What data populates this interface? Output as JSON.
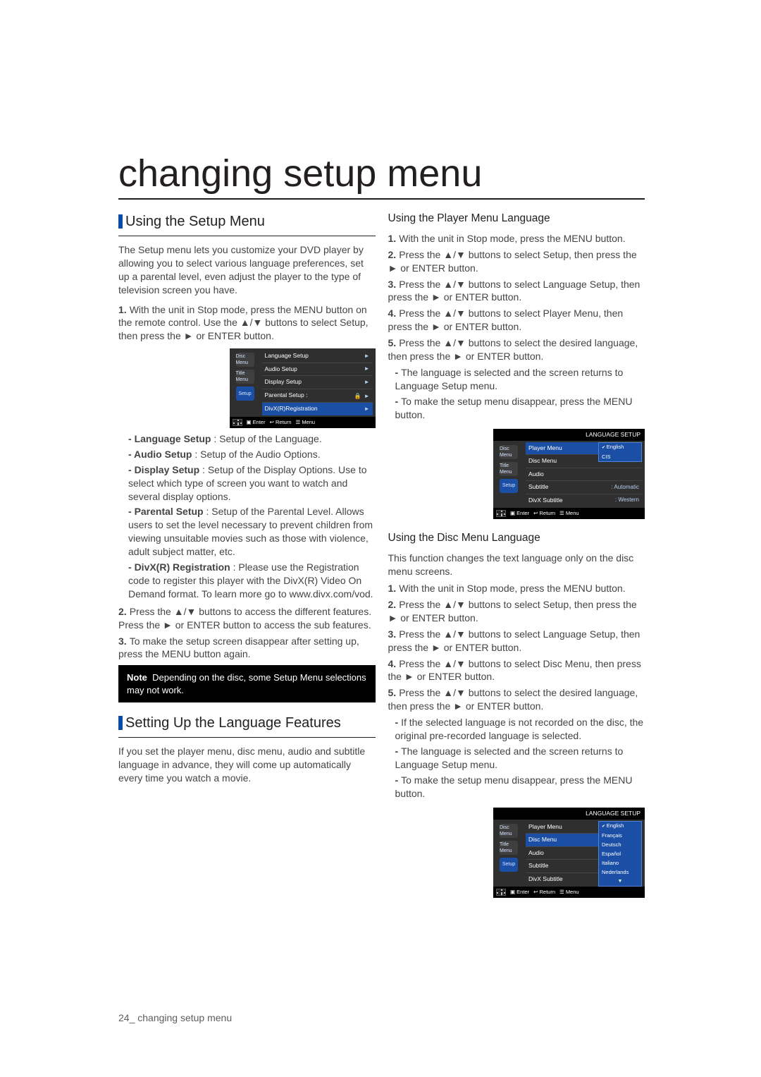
{
  "page_number_label": "24_ changing setup menu",
  "title": "changing setup menu",
  "left": {
    "h2": "Using the Setup Menu",
    "intro": "The Setup menu lets you customize your DVD player by allowing you to select various language preferences, set up a parental level, even adjust the player to the type of television screen you have.",
    "steps": [
      "With the unit in Stop mode, press the MENU button on the remote control. Use the ▲/▼ buttons to select Setup, then press the ► or ENTER button.",
      "Press the ▲/▼ buttons to access the different features. Press the ► or ENTER button to access the sub features.",
      "To make the setup screen disappear after setting up, press the MENU button again."
    ],
    "menu_items": [
      {
        "name": "Language Setup",
        "desc": "Setup of the Language."
      },
      {
        "name": "Audio Setup",
        "desc": "Setup of the Audio Options."
      },
      {
        "name": "Display Setup",
        "desc": "Setup of the Display Options. Use to select which type of screen you want to watch and several display options."
      },
      {
        "name": "Parental Setup",
        "desc": "Setup of the Parental Level. Allows users to set the level necessary to prevent children from viewing unsuitable movies such as those with violence, adult subject matter, etc."
      },
      {
        "name": "DivX(R) Registration",
        "desc": "Please use the Registration code to register this player with the DivX(R) Video On Demand format. To learn more go to www.divx.com/vod."
      }
    ],
    "note": "Depending on the disc, some Setup Menu selections may not work.",
    "lang_h2": "Setting Up the Language Features",
    "lang_p": "If you set the player menu, disc menu, audio and subtitle language in advance, they will come up automatically every time you watch a movie.",
    "mock1": {
      "rows": [
        {
          "l": "Language Setup",
          "r": "►"
        },
        {
          "l": "Audio Setup",
          "r": "►"
        },
        {
          "l": "Display Setup",
          "r": "►"
        },
        {
          "l": "Parental Setup :",
          "r": "🔒 ►"
        },
        {
          "l": "DivX(R)Registration",
          "r": "►",
          "hi": true
        }
      ],
      "icons": [
        "Disc Menu",
        "Title Menu",
        "Setup"
      ],
      "footer": [
        "Enter",
        "Return",
        "Menu"
      ]
    },
    "blackbar_label": "Note"
  },
  "right": {
    "h3a": "Using the Player Menu Language",
    "pm_steps": [
      "With the unit in Stop mode, press the MENU button.",
      "Press the ▲/▼ buttons to select Setup, then press the ► or ENTER button.",
      "Press the ▲/▼ buttons to select Language Setup, then press the ► or ENTER button.",
      "Press the ▲/▼ buttons to select Player Menu, then press the ► or ENTER button.",
      "Press the ▲/▼ buttons to select the desired language, then press the ► or ENTER button."
    ],
    "pm_notes": [
      "The language is selected and the screen returns to Language Setup menu.",
      "To make the setup menu disappear, press the MENU button."
    ],
    "mock2": {
      "title": "LANGUAGE SETUP",
      "rows": [
        {
          "l": "Player Menu",
          "r": ": English",
          "hi": true
        },
        {
          "l": "Disc Menu",
          "r": ""
        },
        {
          "l": "Audio",
          "r": ""
        },
        {
          "l": "Subtitle",
          "r": ": Automatic"
        },
        {
          "l": "DivX Subtitle",
          "r": ": Western"
        }
      ],
      "pick": {
        "sel": "English",
        "other": "CIS"
      },
      "icons": [
        "Disc Menu",
        "Title Menu",
        "Setup"
      ],
      "footer": [
        "Enter",
        "Return",
        "Menu"
      ]
    },
    "h3b": "Using the Disc Menu Language",
    "dm_intro": "This function changes the text language only on the disc menu screens.",
    "dm_steps": [
      "With the unit in Stop mode, press the MENU button.",
      "Press the ▲/▼ buttons to select Setup, then press the ► or ENTER button.",
      "Press the ▲/▼ buttons to select Language Setup, then press the ► or ENTER button.",
      "Press the ▲/▼ buttons to select Disc Menu, then press the ► or ENTER button.",
      "Press the ▲/▼ buttons to select the desired language, then press the ► or ENTER button."
    ],
    "dm_notes": [
      "If the selected language is not recorded on the disc, the original pre-recorded language is selected.",
      "The language is selected and the screen returns to Language Setup menu.",
      "To make the setup menu disappear, press the MENU button."
    ],
    "mock3": {
      "title": "LANGUAGE SETUP",
      "rows": [
        {
          "l": "Player Menu",
          "r": ""
        },
        {
          "l": "Disc Menu",
          "r": "",
          "hi": true
        },
        {
          "l": "Audio",
          "r": ""
        },
        {
          "l": "Subtitle",
          "r": ""
        },
        {
          "l": "DivX Subtitle",
          "r": ""
        }
      ],
      "langs": [
        "English",
        "Français",
        "Deutsch",
        "Español",
        "Italiano",
        "Nederlands",
        "▼"
      ],
      "icons": [
        "Disc Menu",
        "Title Menu",
        "Setup"
      ],
      "footer": [
        "Enter",
        "Return",
        "Menu"
      ]
    }
  }
}
